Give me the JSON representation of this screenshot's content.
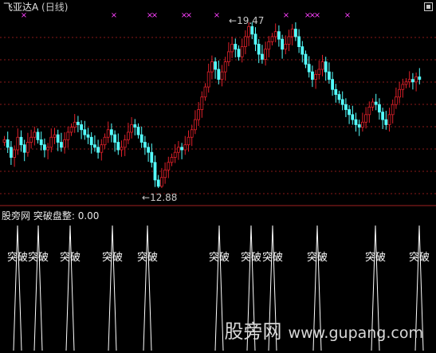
{
  "header": {
    "title": "飞亚达A",
    "period": "(日线)"
  },
  "price_chart": {
    "max_label": "19.47",
    "min_label": "12.88",
    "bull_color": "#e0202a",
    "bear_color": "#54ffff",
    "marker_color": "#ff40ff",
    "grid_color": "#8a1a1a"
  },
  "indicator": {
    "source": "股旁网",
    "name": "突破盘整:",
    "value": "0.00",
    "signal_label": "突破"
  },
  "watermark": {
    "brand": "股旁网",
    "url": "www.gupang.com"
  },
  "chart_data": {
    "type": "candlestick",
    "y_range": [
      12.88,
      19.47
    ],
    "closes": [
      14.8,
      14.5,
      14.1,
      14.4,
      14.9,
      14.6,
      14.3,
      14.7,
      14.9,
      15.1,
      14.8,
      14.6,
      14.4,
      14.5,
      14.9,
      15.0,
      14.7,
      14.5,
      14.8,
      15.1,
      15.3,
      15.5,
      15.4,
      15.2,
      15.0,
      14.9,
      14.6,
      14.5,
      14.3,
      14.6,
      14.9,
      15.2,
      15.0,
      14.7,
      14.4,
      14.5,
      14.8,
      15.1,
      15.4,
      15.3,
      15.0,
      14.7,
      14.5,
      14.3,
      13.9,
      13.2,
      12.95,
      13.3,
      13.6,
      13.9,
      14.1,
      14.3,
      14.5,
      14.4,
      14.6,
      14.9,
      15.2,
      15.6,
      16.0,
      16.5,
      16.9,
      17.5,
      17.9,
      17.6,
      17.2,
      17.5,
      17.9,
      18.3,
      18.6,
      18.4,
      18.1,
      18.5,
      18.9,
      19.3,
      19.0,
      18.6,
      18.2,
      18.0,
      18.4,
      18.7,
      18.9,
      19.1,
      18.8,
      18.4,
      18.6,
      18.9,
      19.2,
      18.9,
      18.5,
      18.2,
      17.8,
      17.5,
      17.2,
      17.4,
      17.6,
      17.9,
      17.5,
      17.2,
      16.8,
      16.6,
      16.4,
      16.2,
      16.0,
      15.8,
      15.6,
      15.4,
      15.3,
      15.5,
      15.8,
      16.1,
      16.3,
      16.2,
      15.9,
      15.6,
      15.4,
      15.8,
      16.2,
      16.5,
      16.8,
      17.0,
      17.1,
      17.2,
      17.1,
      17.3,
      17.2
    ]
  }
}
